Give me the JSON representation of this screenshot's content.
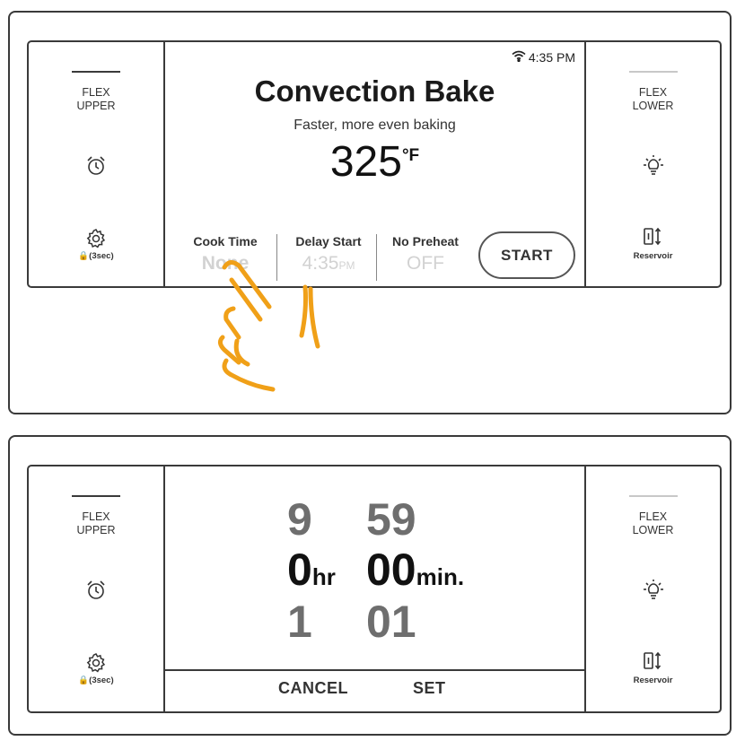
{
  "top_panel": {
    "left_side": {
      "flex_label": "FLEX UPPER",
      "lock_label": "🔒(3sec)"
    },
    "right_side": {
      "flex_label": "FLEX LOWER",
      "reservoir_label": "Reservoir"
    },
    "status": {
      "time": "4:35 PM"
    },
    "mode_title": "Convection Bake",
    "mode_subtitle": "Faster, more even baking",
    "temperature": "325",
    "temperature_unit": "°F",
    "options": [
      {
        "label": "Cook Time",
        "value": "None"
      },
      {
        "label": "Delay Start",
        "value": "4:35",
        "suffix": "PM"
      },
      {
        "label": "No Preheat",
        "value": "OFF"
      }
    ],
    "start_label": "START"
  },
  "bottom_panel": {
    "left_side": {
      "flex_label": "FLEX UPPER",
      "lock_label": "🔒(3sec)"
    },
    "right_side": {
      "flex_label": "FLEX LOWER",
      "reservoir_label": "Reservoir"
    },
    "hours": {
      "prev": "9",
      "current": "0",
      "next": "1",
      "unit": "hr"
    },
    "minutes": {
      "prev": "59",
      "current": "00",
      "next": "01",
      "unit": "min."
    },
    "cancel_label": "CANCEL",
    "set_label": "SET"
  },
  "icons": [
    "alarm-clock-icon",
    "gear-icon",
    "light-bulb-icon",
    "reservoir-icon",
    "wifi-icon",
    "hand-pointer-icon"
  ],
  "colors": {
    "frame": "#3a3a3a",
    "dim_value": "#d2d2d2",
    "hand": "#f0a018"
  }
}
